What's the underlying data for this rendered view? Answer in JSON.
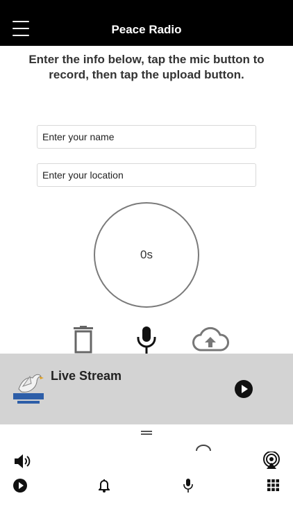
{
  "header": {
    "title": "Peace Radio"
  },
  "instructions": {
    "text": "Enter the info below, tap the mic button to record, then tap the upload button."
  },
  "form": {
    "name_placeholder": "Enter your name",
    "location_placeholder": "Enter your location"
  },
  "recorder": {
    "timer": "0s",
    "icons": [
      "trash-icon",
      "microphone-icon",
      "cloud-upload-icon"
    ]
  },
  "player": {
    "title": "Live Stream",
    "logo": "peace-radio-dove-logo",
    "play_icon": "play-icon"
  },
  "bottom_controls": {
    "row1": [
      "volume-icon",
      "airplay-icon"
    ],
    "row2": [
      "play-icon",
      "bell-icon",
      "microphone-icon",
      "grid-icon"
    ]
  },
  "colors": {
    "header_bg": "#000000",
    "player_bg": "#d3d3d3",
    "icon": "#111111"
  }
}
